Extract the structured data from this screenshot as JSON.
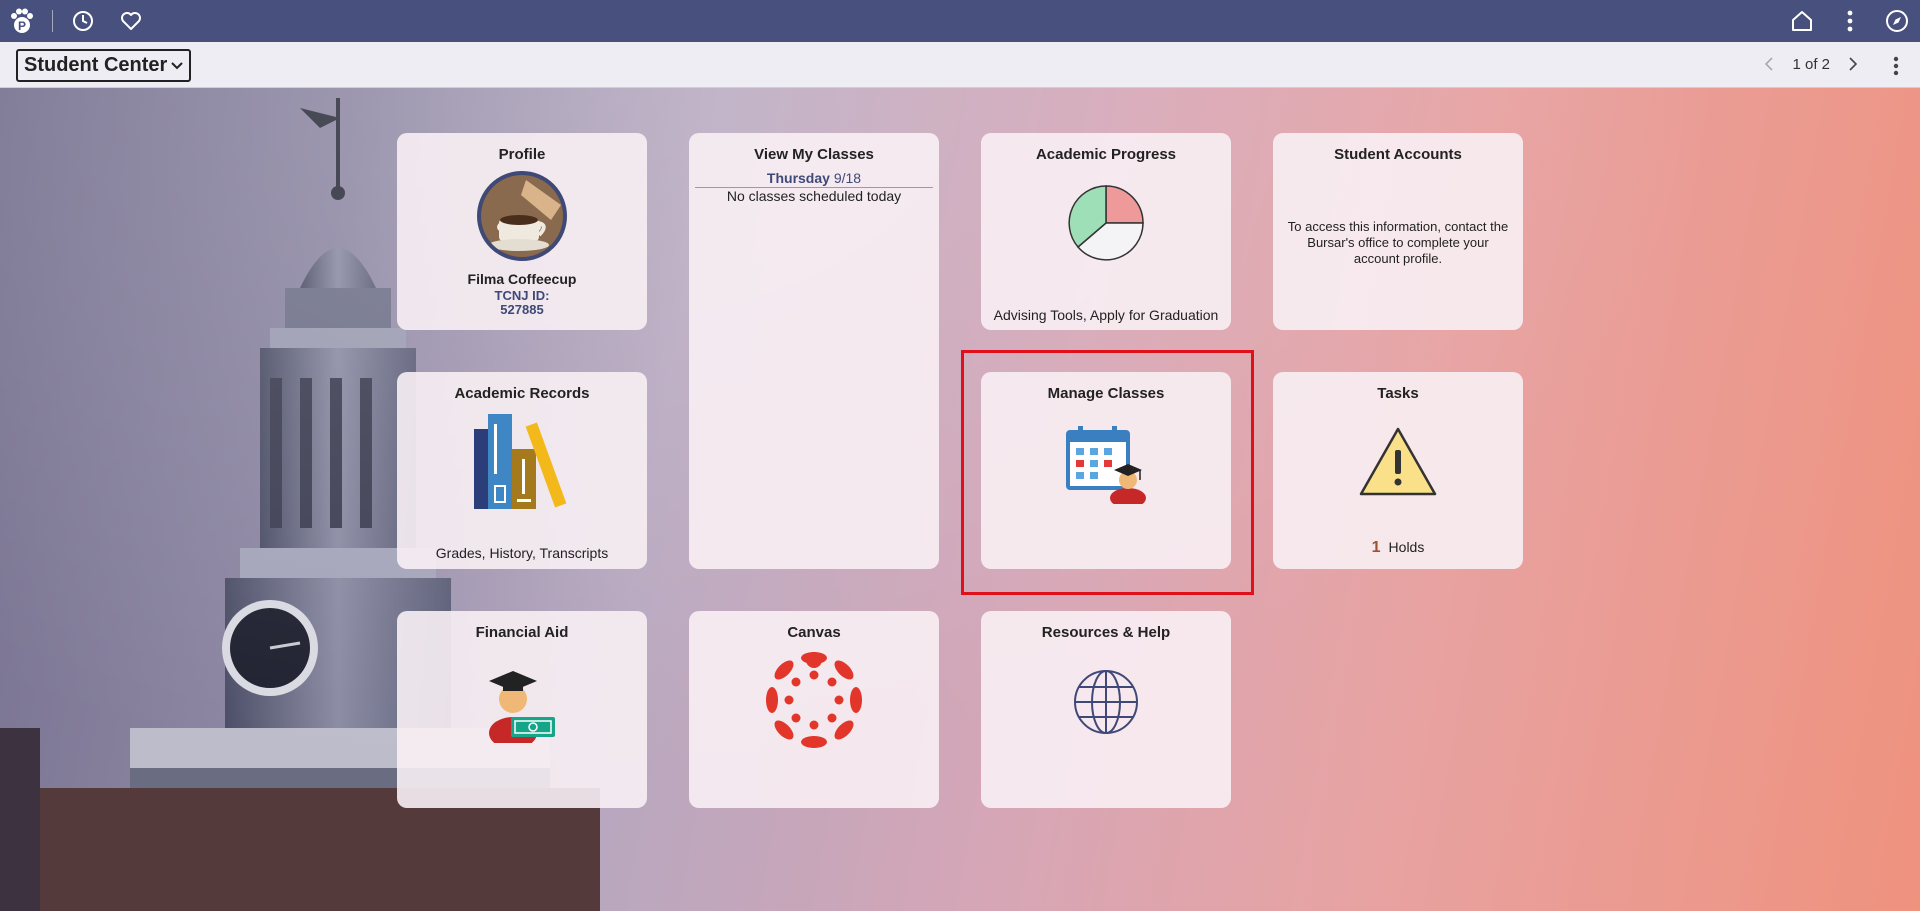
{
  "topbar": {
    "logo_icon": "paw-p-logo-icon",
    "recent_icon": "clock-icon",
    "favorites_icon": "heart-icon",
    "home_icon": "home-icon",
    "actions_icon": "vertical-dots-icon",
    "navbar_icon": "compass-icon"
  },
  "titlebar": {
    "homepage": "Student Center",
    "pager_text": "1 of 2"
  },
  "tiles": {
    "profile": {
      "title": "Profile",
      "name": "Filma Coffeecup",
      "id_label": "TCNJ ID:",
      "id_value": "527885"
    },
    "classes": {
      "title": "View My Classes",
      "day": "Thursday",
      "date": "9/18",
      "message": "No classes scheduled today"
    },
    "progress": {
      "title": "Academic Progress",
      "footer": "Advising Tools, Apply for Graduation"
    },
    "accounts": {
      "title": "Student Accounts",
      "message": "To access this information, contact the Bursar's office to complete your account profile."
    },
    "records": {
      "title": "Academic Records",
      "footer": "Grades, History, Transcripts"
    },
    "manage": {
      "title": "Manage Classes"
    },
    "tasks": {
      "title": "Tasks",
      "count": "1",
      "label": "Holds"
    },
    "aid": {
      "title": "Financial Aid"
    },
    "canvas": {
      "title": "Canvas"
    },
    "resources": {
      "title": "Resources & Help"
    }
  },
  "colors": {
    "topbar": "#48507e",
    "accent": "#3f4977",
    "highlight": "#e0101a"
  }
}
